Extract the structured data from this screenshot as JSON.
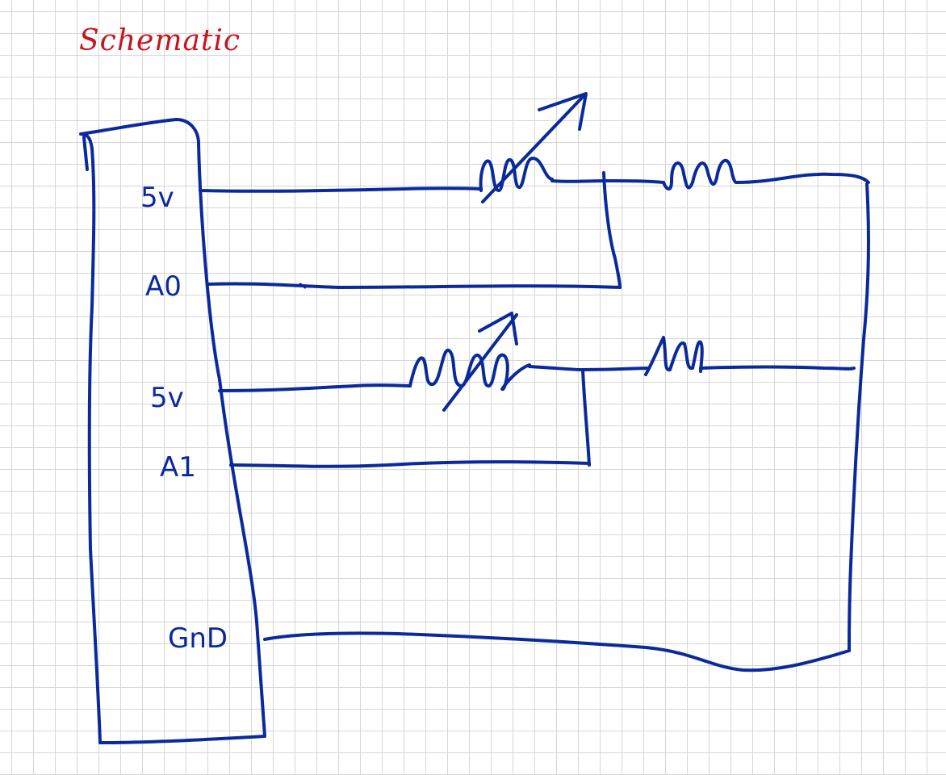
{
  "title": "Schematic",
  "pins": [
    {
      "label": "5v"
    },
    {
      "label": "A0"
    },
    {
      "label": "5v"
    },
    {
      "label": "A1"
    },
    {
      "label": "GnD"
    }
  ],
  "colors": {
    "title_ink": "#c8141e",
    "wire_ink": "#0a2a9c",
    "grid": "#d6d6d6",
    "paper": "#ffffff"
  },
  "components": [
    {
      "type": "variable-resistor",
      "icon": "photoresistor-icon"
    },
    {
      "type": "resistor",
      "icon": "resistor-icon"
    },
    {
      "type": "variable-resistor",
      "icon": "photoresistor-icon"
    },
    {
      "type": "resistor",
      "icon": "resistor-icon"
    }
  ]
}
